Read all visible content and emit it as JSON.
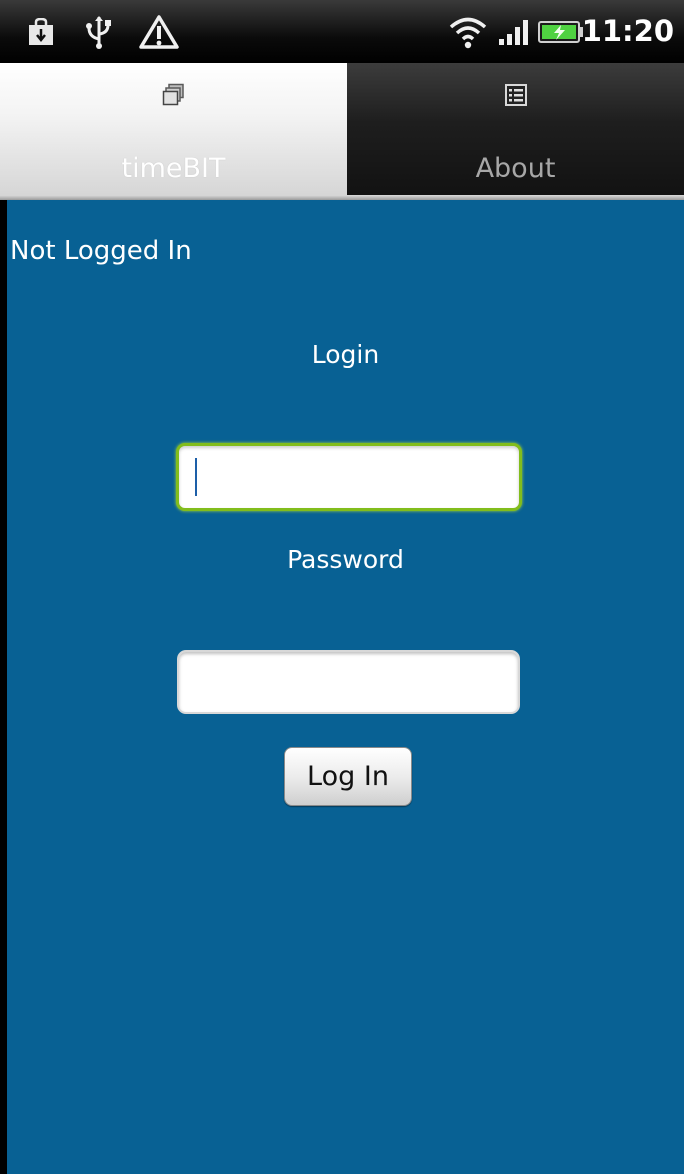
{
  "status_bar": {
    "time": "11:20",
    "icons": [
      "download-icon",
      "usb-icon",
      "warning-icon",
      "wifi-icon",
      "signal-icon",
      "battery-charging-icon"
    ]
  },
  "tabs": [
    {
      "label": "timeBIT",
      "icon": "windows-icon",
      "selected": true
    },
    {
      "label": "About",
      "icon": "list-icon",
      "selected": false
    }
  ],
  "main": {
    "status": "Not Logged In",
    "login_label": "Login",
    "login_value": "",
    "password_label": "Password",
    "password_value": "",
    "login_button": "Log In"
  },
  "colors": {
    "background": "#086194",
    "focus_border": "#82bd1c"
  }
}
